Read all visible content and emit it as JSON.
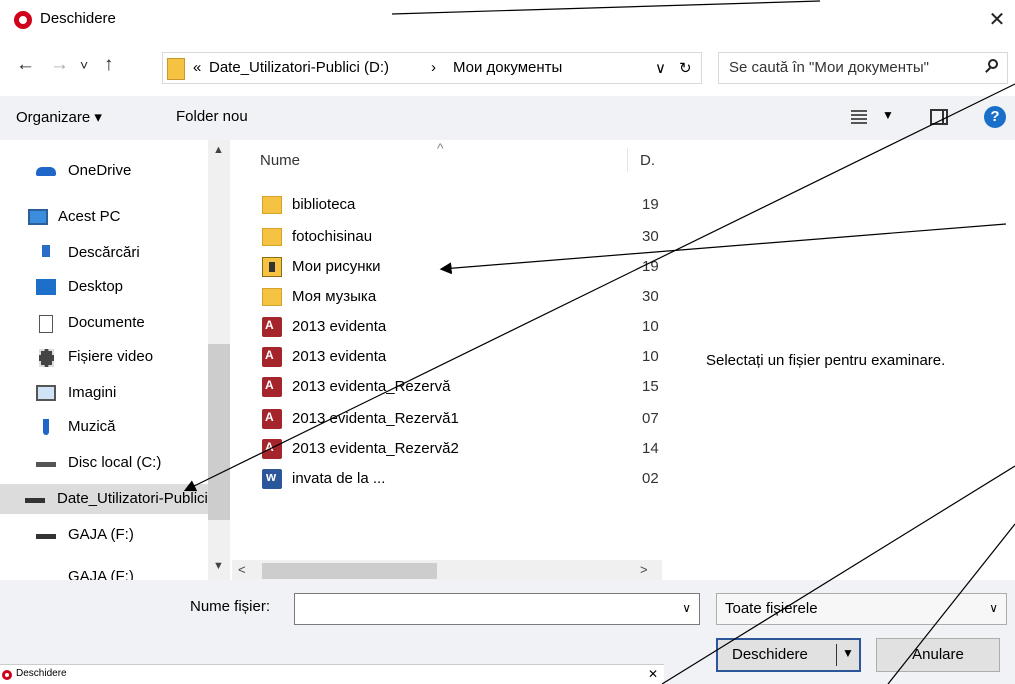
{
  "window": {
    "title": "Deschidere",
    "close_glyph": "✕"
  },
  "nav": {
    "back_glyph": "←",
    "forward_glyph": "→",
    "recent_glyph": "˅",
    "up_glyph": "↑",
    "breadcrumb_sep": "«",
    "breadcrumb": [
      "Date_Utilizatori-Publici (D:)",
      "Мои документы"
    ],
    "crumb_arrow": "›",
    "addr_dropdown_glyph": "∨",
    "refresh_glyph": "↻",
    "search_placeholder": "Se caută în \"Мои документы\""
  },
  "toolbar": {
    "organize_label": "Organizare ▾",
    "new_folder_label": "Folder nou",
    "view_dropdown_glyph": "▼",
    "help_glyph": "?"
  },
  "sidebar": {
    "items": [
      {
        "label": "OneDrive",
        "icon": "onedrive-icon"
      },
      {
        "label": "Acest PC",
        "icon": "computer-icon"
      },
      {
        "label": "Descărcări",
        "icon": "download-icon"
      },
      {
        "label": "Desktop",
        "icon": "desktop-icon"
      },
      {
        "label": "Documente",
        "icon": "documents-icon"
      },
      {
        "label": "Fișiere video",
        "icon": "video-icon"
      },
      {
        "label": "Imagini",
        "icon": "pictures-icon"
      },
      {
        "label": "Muzică",
        "icon": "music-icon"
      },
      {
        "label": "Disc local (C:)",
        "icon": "drive-icon"
      },
      {
        "label": "Date_Utilizatori-Publici (D:)",
        "icon": "drive-icon"
      },
      {
        "label": "GAJA (F:)",
        "icon": "drive-icon"
      },
      {
        "label": "GAJA (F:)",
        "icon": "drive-icon"
      }
    ],
    "scroll_up_glyph": "▲",
    "scroll_down_glyph": "▼"
  },
  "filelist": {
    "col_name": "Nume",
    "col_date": "D.",
    "sort_glyph": "^",
    "files": [
      {
        "name": "biblioteca",
        "date": "19",
        "icon": "folder-icon"
      },
      {
        "name": "fotochisinau",
        "date": "30",
        "icon": "folder-icon"
      },
      {
        "name": "Мои рисунки",
        "date": "19",
        "icon": "pictures-folder-icon"
      },
      {
        "name": "Моя музыка",
        "date": "30",
        "icon": "folder-icon"
      },
      {
        "name": "2013 evidenta",
        "date": "10",
        "icon": "access-icon"
      },
      {
        "name": "2013 evidenta",
        "date": "10",
        "icon": "access-locked-icon"
      },
      {
        "name": "2013 evidenta_Rezervă",
        "date": "15",
        "icon": "access-icon"
      },
      {
        "name": "2013 evidenta_Rezervă1",
        "date": "07",
        "icon": "access-icon"
      },
      {
        "name": "2013 evidenta_Rezervă2",
        "date": "14",
        "icon": "access-icon"
      },
      {
        "name": "invata de la ...",
        "date": "02",
        "icon": "word-icon"
      }
    ],
    "scroll_left_glyph": "<",
    "scroll_right_glyph": ">"
  },
  "preview": {
    "message": "Selectați un fișier pentru examinare."
  },
  "footer": {
    "filename_label": "Nume fișier:",
    "filename_value": "",
    "filename_dropdown_glyph": "∨",
    "filetype_label": "Toate fișierele",
    "filetype_dropdown_glyph": "∨",
    "open_label": "Deschidere",
    "open_dropdown_glyph": "▼",
    "cancel_label": "Anulare"
  },
  "ghost": {
    "title": "Deschidere",
    "close_glyph": "✕"
  },
  "colors": {
    "accent": "#2b579a",
    "brand": "#d0021b",
    "toolbar_bg": "#f0f2f5",
    "selection": "#dcdcdc"
  }
}
